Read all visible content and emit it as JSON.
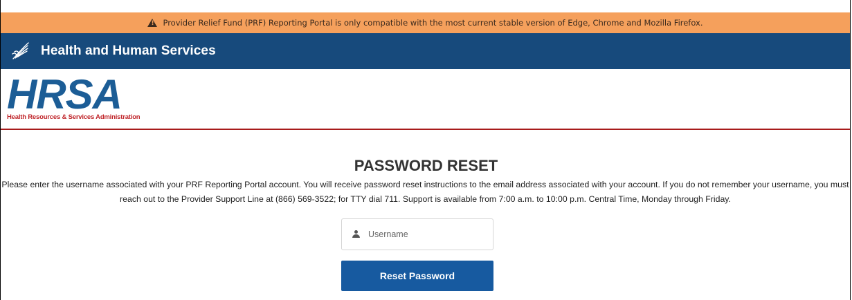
{
  "alert": {
    "icon": "warning-icon",
    "text": "Provider Relief Fund (PRF) Reporting Portal is only compatible with the most current stable version of Edge, Chrome and Mozilla Firefox.",
    "color": "#f5a05c"
  },
  "header": {
    "logo_icon": "hhs-eagle-icon",
    "title": "Health and Human Services",
    "color": "#174a7c"
  },
  "brand": {
    "name": "HRSA",
    "subtitle": "Health Resources & Services Administration",
    "primary_color": "#1c5d96",
    "accent_color": "#c0262b"
  },
  "main": {
    "title": "PASSWORD RESET",
    "description": "Please enter the username associated with your PRF Reporting Portal account. You will receive password reset instructions to the email address associated with your account. If you do not remember your username, you must reach out to the Provider Support Line at (866) 569-3522; for TTY dial 711. Support is available from 7:00 a.m. to 10:00 p.m. Central Time, Monday through Friday.",
    "username": {
      "icon": "user-icon",
      "placeholder": "Username",
      "value": ""
    },
    "reset_button_label": "Reset Password",
    "button_color": "#175aa0"
  }
}
